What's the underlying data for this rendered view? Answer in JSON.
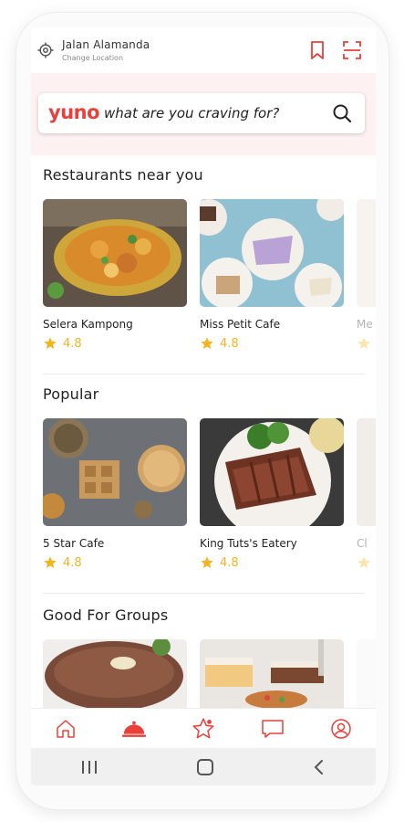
{
  "header": {
    "location_title": "Jalan Alamanda",
    "location_subtitle": "Change Location",
    "icons": [
      "location-target-icon",
      "bookmark-icon",
      "scan-icon"
    ]
  },
  "search": {
    "brand": "yuno",
    "placeholder": "what are you craving for?",
    "icon": "search-icon"
  },
  "sections": [
    {
      "title": "Restaurants near you",
      "cards": [
        {
          "name": "Selera Kampong",
          "rating": "4.8"
        },
        {
          "name": "Miss Petit Cafe",
          "rating": "4.8"
        },
        {
          "name": "Me",
          "rating": ""
        }
      ]
    },
    {
      "title": "Popular",
      "cards": [
        {
          "name": "5 Star Cafe",
          "rating": "4.8"
        },
        {
          "name": "King Tuts's Eatery",
          "rating": "4.8"
        },
        {
          "name": "Cl",
          "rating": ""
        }
      ]
    },
    {
      "title": "Good For Groups",
      "cards": [
        {
          "name": "",
          "rating": ""
        },
        {
          "name": "",
          "rating": ""
        }
      ]
    }
  ],
  "bottom_nav": [
    "home-icon",
    "dining-cloche-icon",
    "star-badge-icon",
    "chat-icon",
    "profile-icon"
  ],
  "system_nav": [
    "recents-icon",
    "home-circle-icon",
    "back-icon"
  ],
  "colors": {
    "accent": "#e8403b",
    "star": "#f2b521",
    "search_band": "#fdf1f1"
  }
}
